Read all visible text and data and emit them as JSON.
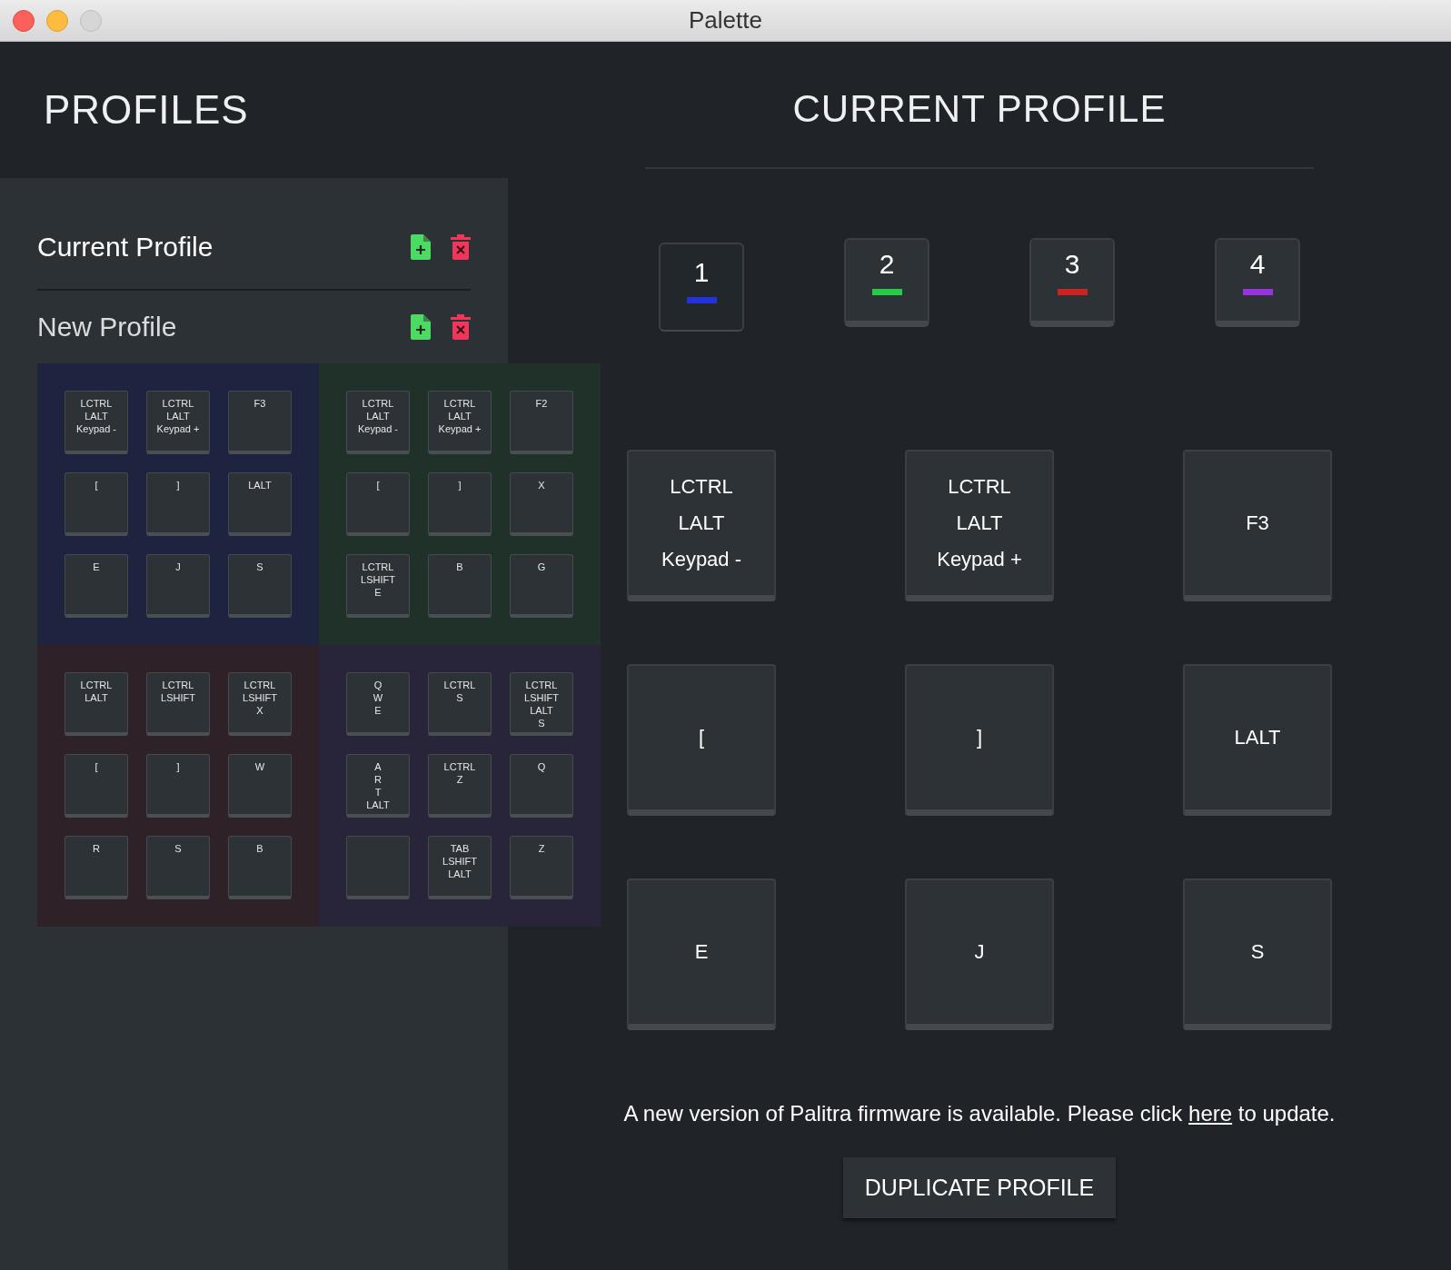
{
  "window": {
    "title": "Palette"
  },
  "sidebar": {
    "title": "PROFILES",
    "profiles": [
      {
        "name": "Current Profile",
        "selected": true
      },
      {
        "name": "New Profile",
        "selected": false
      }
    ],
    "palette": [
      {
        "color": "#1e2440",
        "keys": [
          {
            "kind": "labeled",
            "label": "LCTRL\nLALT\nKeypad -"
          },
          {
            "kind": "labeled",
            "label": "LCTRL\nLALT\nKeypad +"
          },
          {
            "kind": "labeled",
            "label": "F3"
          },
          {
            "kind": "labeled",
            "label": "["
          },
          {
            "kind": "labeled",
            "label": "]"
          },
          {
            "kind": "labeled",
            "label": "LALT"
          },
          {
            "kind": "labeled",
            "label": "E"
          },
          {
            "kind": "labeled",
            "label": "J"
          },
          {
            "kind": "labeled",
            "label": "S"
          }
        ]
      },
      {
        "color": "#1f3129",
        "keys": [
          {
            "kind": "labeled",
            "label": "LCTRL\nLALT\nKeypad -"
          },
          {
            "kind": "labeled",
            "label": "LCTRL\nLALT\nKeypad +"
          },
          {
            "kind": "labeled",
            "label": "F2"
          },
          {
            "kind": "labeled",
            "label": "["
          },
          {
            "kind": "labeled",
            "label": "]"
          },
          {
            "kind": "labeled",
            "label": "X"
          },
          {
            "kind": "labeled",
            "label": "LCTRL\nLSHIFT\nE"
          },
          {
            "kind": "labeled",
            "label": "B"
          },
          {
            "kind": "labeled",
            "label": "G"
          }
        ]
      },
      {
        "color": "#2e2127",
        "keys": [
          {
            "kind": "labeled",
            "label": "LCTRL\nLALT"
          },
          {
            "kind": "labeled",
            "label": "LCTRL\nLSHIFT"
          },
          {
            "kind": "labeled",
            "label": "LCTRL\nLSHIFT\nX"
          },
          {
            "kind": "labeled",
            "label": "["
          },
          {
            "kind": "labeled",
            "label": "]"
          },
          {
            "kind": "labeled",
            "label": "W"
          },
          {
            "kind": "labeled",
            "label": "R"
          },
          {
            "kind": "labeled",
            "label": "S"
          },
          {
            "kind": "labeled",
            "label": "B"
          }
        ]
      },
      {
        "color": "#28253a",
        "keys": [
          {
            "kind": "labeled",
            "label": "Q\nW\nE"
          },
          {
            "kind": "labeled",
            "label": "LCTRL\nS"
          },
          {
            "kind": "labeled",
            "label": "LCTRL\nLSHIFT\nLALT\nS"
          },
          {
            "kind": "labeled",
            "label": "A\nR\nT\nLALT"
          },
          {
            "kind": "labeled",
            "label": "LCTRL\nZ"
          },
          {
            "kind": "labeled",
            "label": "Q"
          },
          {
            "kind": "blank"
          },
          {
            "kind": "labeled",
            "label": "TAB\nLSHIFT\nLALT"
          },
          {
            "kind": "labeled",
            "label": "Z"
          }
        ]
      }
    ]
  },
  "main": {
    "title": "CURRENT PROFILE",
    "layers": [
      {
        "label": "1",
        "color": "#2233dd",
        "selected": true
      },
      {
        "label": "2",
        "color": "#22cc44",
        "selected": false
      },
      {
        "label": "3",
        "color": "#cc2222",
        "selected": false
      },
      {
        "label": "4",
        "color": "#9933dd",
        "selected": false
      }
    ],
    "keys": [
      "LCTRL\nLALT\nKeypad -",
      "LCTRL\nLALT\nKeypad +",
      "F3",
      "[",
      "]",
      "LALT",
      "E",
      "J",
      "S"
    ],
    "message": {
      "before": "A new version of Palitra firmware is available. Please click ",
      "link": "here",
      "after": " to update."
    },
    "button": "DUPLICATE PROFILE"
  }
}
